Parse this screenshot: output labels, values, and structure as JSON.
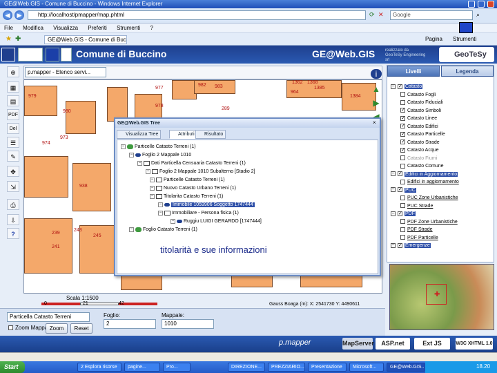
{
  "browser": {
    "title": "GE@Web.GIS - Comune di Buccino - Windows Internet Explorer",
    "address": "http://localhost/pmapper/map.phtml",
    "search_placeholder": "Google",
    "menu": [
      "File",
      "Modifica",
      "Visualizza",
      "Preferiti",
      "Strumenti",
      "?"
    ],
    "tab_label": "GE@Web.GIS - Comune di Buccino",
    "page_menu": [
      "Pagina",
      "Strumenti"
    ]
  },
  "header": {
    "title": "Comune di Buccino",
    "brand": "GE@Web.GIS",
    "partner": "realizzato da GeoTeSy Engineering srl",
    "partner_logo": "GeoTeSy"
  },
  "map": {
    "selector_value": "p.mapper - Elenco servi...",
    "scale_label": "Scala 1:1500",
    "scale_ticks": [
      "0",
      "21",
      "42"
    ],
    "coords": "Gauss Boaga (m): X: 2541730 Y: 4490611",
    "parcel_numbers": [
      "977",
      "979",
      "973",
      "978",
      "974",
      "980",
      "982",
      "983",
      "964",
      "938",
      "239",
      "241",
      "243",
      "245",
      "289",
      "1362",
      "1368",
      "1385",
      "1384"
    ]
  },
  "tree_window": {
    "title": "GE@Web.GIS Tree",
    "tabs": [
      "Visualizza Tree",
      "Attributi",
      "Risultato"
    ],
    "nodes": [
      {
        "text": "Particelle Catasto Terreni (1)"
      },
      {
        "text": "Foglio 2 Mappale 1010"
      },
      {
        "text": "Dati Particella Censuaria Catasto Terreni (1)"
      },
      {
        "text": "Foglio 2 Mappale 1010 Subalterno [Stadio 2]"
      },
      {
        "text": "Particelle Catasto Terreni (1)"
      },
      {
        "text": "Nuovo Catasto Urbano Terreni (1)"
      },
      {
        "text": "Titolarita Catasto Terreni (1)"
      },
      {
        "text": "Immobile 1059906 Soggetto 1747444"
      },
      {
        "text": "Immobiliare - Persona fisica (1)"
      },
      {
        "text": "Ruggiu LUIGI GERARDO [1747444]"
      },
      {
        "text": "Foglio Catasto Terreni (1)"
      }
    ],
    "caption": "titolarità e sue informazioni"
  },
  "form": {
    "layer_select": "Particella Catasto Terreni",
    "foglio_label": "Foglio:",
    "foglio_value": "2",
    "mappale_label": "Mappale:",
    "mappale_value": "1010",
    "zoom_label": "Zoom Mappa",
    "zoom_button": "Zoom",
    "reset_button": "Reset"
  },
  "panel": {
    "tabs": [
      "Livelli",
      "Legenda"
    ],
    "layers": [
      {
        "label": "Catasto",
        "checked": true,
        "level": 0,
        "style": "bold"
      },
      {
        "label": "Catasto Fogli",
        "checked": false,
        "level": 1
      },
      {
        "label": "Catasto Fiduciali",
        "checked": false,
        "level": 1
      },
      {
        "label": "Catasto Simboli",
        "checked": true,
        "level": 1
      },
      {
        "label": "Catasto Linee",
        "checked": true,
        "level": 1
      },
      {
        "label": "Catasto Edifici",
        "checked": true,
        "level": 1
      },
      {
        "label": "Catasto Particelle",
        "checked": true,
        "level": 1
      },
      {
        "label": "Catasto Strade",
        "checked": true,
        "level": 1
      },
      {
        "label": "Catasto Acque",
        "checked": true,
        "level": 1
      },
      {
        "label": "Catasto Fiumi",
        "checked": false,
        "level": 1,
        "style": "grey"
      },
      {
        "label": "Catasto Comune",
        "checked": false,
        "level": 1
      },
      {
        "label": "Edifici in Aggiornamento",
        "checked": true,
        "level": 0,
        "style": "bold"
      },
      {
        "label": "Edifici in aggiornamento",
        "checked": false,
        "level": 1
      },
      {
        "label": "PUC",
        "checked": true,
        "level": 0,
        "style": "bold"
      },
      {
        "label": "PUC Zone Urbanistiche",
        "checked": false,
        "level": 1
      },
      {
        "label": "PUC Strade",
        "checked": false,
        "level": 1
      },
      {
        "label": "PDF",
        "checked": true,
        "level": 0,
        "style": "bold"
      },
      {
        "label": "PDF Zone Urbanistiche",
        "checked": false,
        "level": 1
      },
      {
        "label": "PDF Strade",
        "checked": false,
        "level": 1
      },
      {
        "label": "PDF Particelle",
        "checked": false,
        "level": 1
      },
      {
        "label": "Emergenze",
        "checked": true,
        "level": 0,
        "style": "bold"
      }
    ]
  },
  "footer": {
    "logos": [
      "p.mapper",
      "MapServer",
      "ASP.net",
      "Ext JS",
      "W3C XHTML 1.0"
    ]
  },
  "taskbar": {
    "start": "Start",
    "tasks": [
      "2 Esplora risorse",
      "pagine...",
      "Pro...",
      "DIREZIONE...",
      "PREZZIARIO...",
      "Presentazione",
      "Microsoft...",
      "GE@Web.GIS..."
    ],
    "tray_time": "18.20"
  },
  "colors": {
    "header_blue": "#1f3f8e",
    "parcel_fill": "#f4a86a",
    "selection": "#2e4fa8"
  }
}
